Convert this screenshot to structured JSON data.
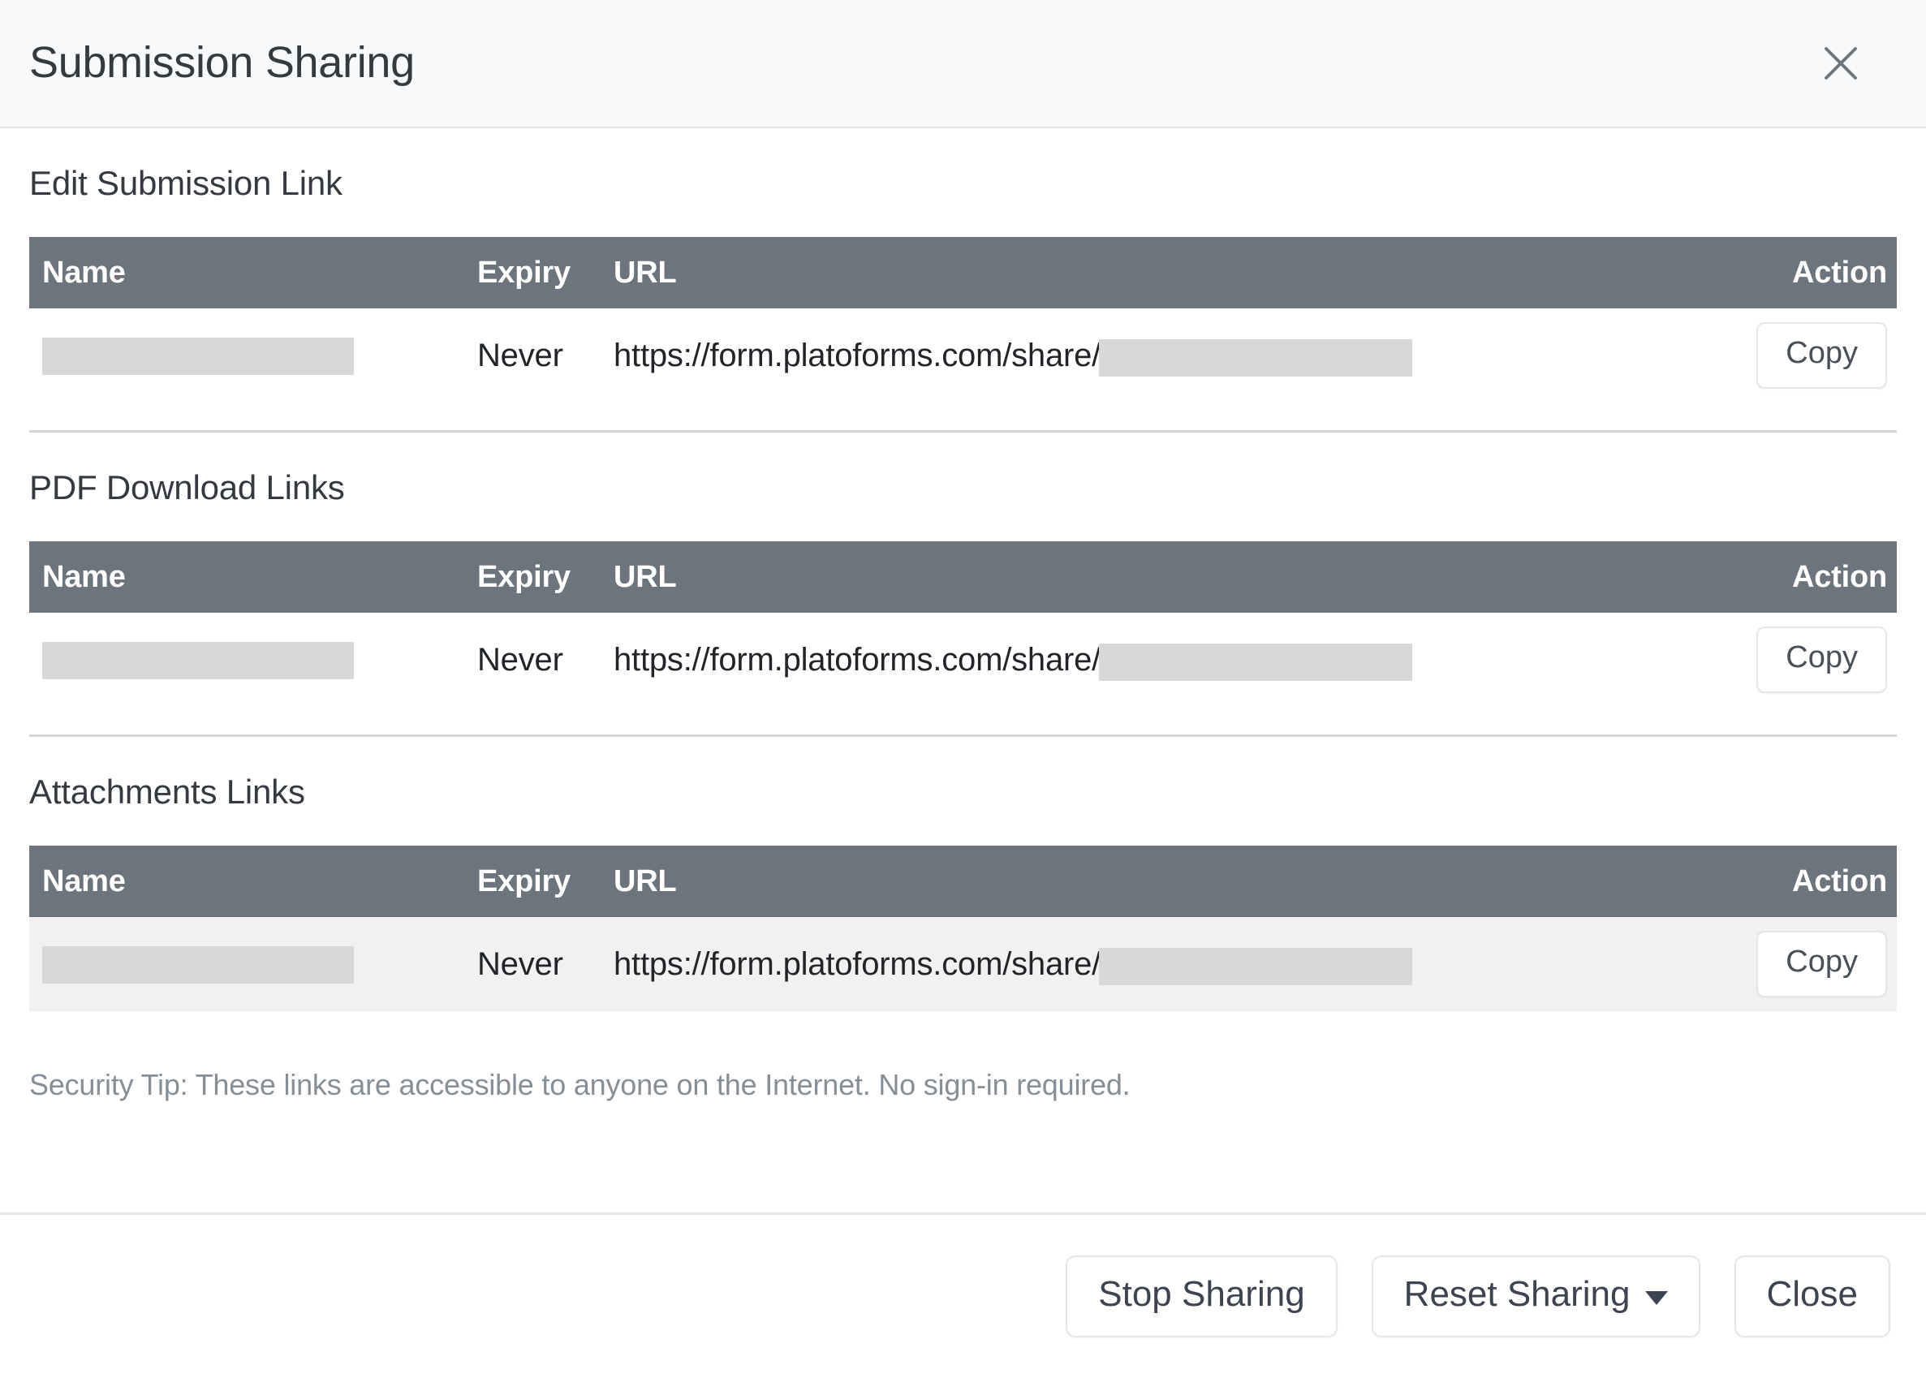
{
  "header": {
    "title": "Submission Sharing",
    "close_icon": "close-icon"
  },
  "sections": [
    {
      "title": "Edit Submission Link",
      "columns": {
        "name": "Name",
        "expiry": "Expiry",
        "url": "URL",
        "action": "Action"
      },
      "row": {
        "name": "",
        "expiry": "Never",
        "url_prefix": "https://form.platoforms.com/share/",
        "url_suffix": "",
        "action_label": "Copy"
      }
    },
    {
      "title": "PDF Download Links",
      "columns": {
        "name": "Name",
        "expiry": "Expiry",
        "url": "URL",
        "action": "Action"
      },
      "row": {
        "name": "",
        "expiry": "Never",
        "url_prefix": "https://form.platoforms.com/share/",
        "url_suffix": "",
        "action_label": "Copy"
      }
    },
    {
      "title": "Attachments Links",
      "columns": {
        "name": "Name",
        "expiry": "Expiry",
        "url": "URL",
        "action": "Action"
      },
      "row": {
        "name": "",
        "expiry": "Never",
        "url_prefix": "https://form.platoforms.com/share/",
        "url_suffix": "",
        "action_label": "Copy"
      }
    }
  ],
  "security_tip": "Security Tip: These links are accessible to anyone on the Internet. No sign-in required.",
  "footer": {
    "stop_sharing_label": "Stop Sharing",
    "reset_sharing_label": "Reset Sharing",
    "reset_sharing_caret": "chevron-down-icon",
    "close_label": "Close"
  },
  "colors": {
    "header_bg": "#f8f9fa",
    "table_header_bg": "#6c757d",
    "table_header_text": "#ffffff",
    "striped_row_bg": "#f1f1f1",
    "redaction_bar": "#d8d8d8",
    "muted_text": "#868e96",
    "body_text": "#212529"
  }
}
